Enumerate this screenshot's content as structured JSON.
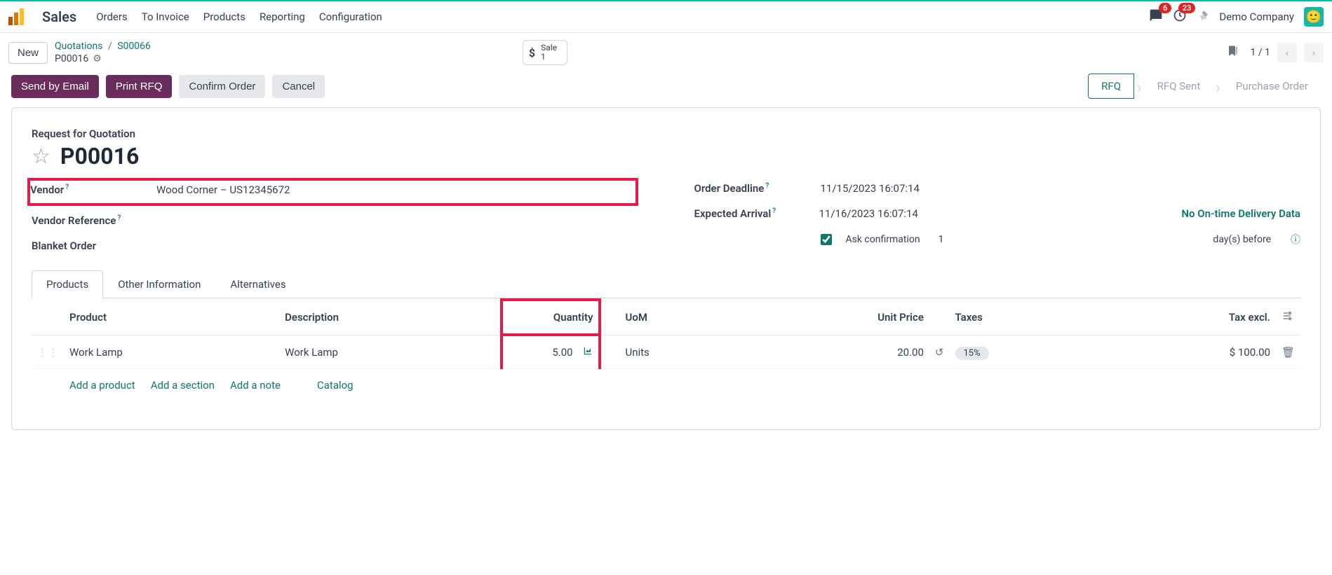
{
  "nav": {
    "app": "Sales",
    "items": [
      "Orders",
      "To Invoice",
      "Products",
      "Reporting",
      "Configuration"
    ],
    "messages_badge": "6",
    "activities_badge": "23",
    "company": "Demo Company"
  },
  "breadcrumb": {
    "new_label": "New",
    "root": "Quotations",
    "parent": "S00066",
    "current": "P00016",
    "pager": "1 / 1",
    "sale_button": {
      "label": "Sale",
      "count": "1"
    }
  },
  "actions": {
    "send_email": "Send by Email",
    "print": "Print RFQ",
    "confirm": "Confirm Order",
    "cancel": "Cancel",
    "statuses": [
      "RFQ",
      "RFQ Sent",
      "Purchase Order"
    ]
  },
  "form": {
    "subtitle": "Request for Quotation",
    "id": "P00016",
    "vendor_label": "Vendor",
    "vendor_value": "Wood Corner – US12345672",
    "vendor_ref_label": "Vendor Reference",
    "blanket_label": "Blanket Order",
    "deadline_label": "Order Deadline",
    "deadline_value": "11/15/2023 16:07:14",
    "arrival_label": "Expected Arrival",
    "arrival_value": "11/16/2023 16:07:14",
    "no_ontime": "No On-time Delivery Data",
    "ask_conf_label": "Ask confirmation",
    "ask_days": "1",
    "days_before": "day(s) before"
  },
  "tabs": [
    "Products",
    "Other Information",
    "Alternatives"
  ],
  "table": {
    "headers": {
      "product": "Product",
      "description": "Description",
      "quantity": "Quantity",
      "uom": "UoM",
      "unit_price": "Unit Price",
      "taxes": "Taxes",
      "tax_excl": "Tax excl."
    },
    "rows": [
      {
        "product": "Work Lamp",
        "description": "Work Lamp",
        "quantity": "5.00",
        "uom": "Units",
        "unit_price": "20.00",
        "taxes": "15%",
        "tax_excl": "$ 100.00"
      }
    ],
    "add": {
      "product": "Add a product",
      "section": "Add a section",
      "note": "Add a note",
      "catalog": "Catalog"
    }
  }
}
